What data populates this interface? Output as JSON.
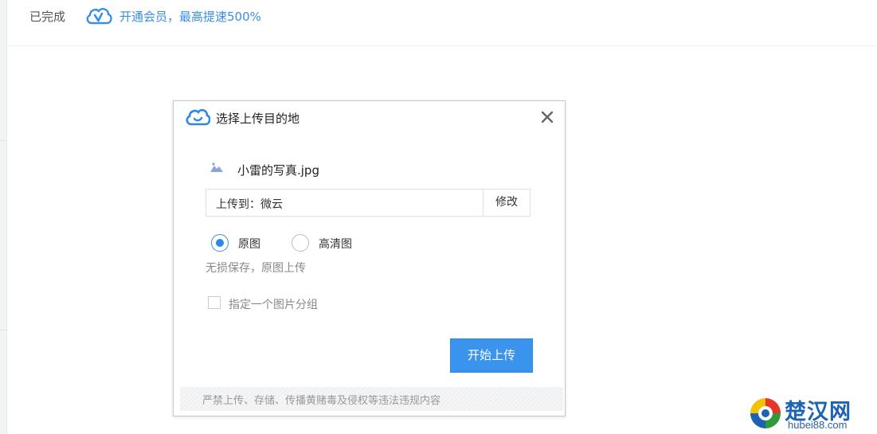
{
  "topbar": {
    "status_text": "已完成",
    "vip_link": "开通会员，最高提速500%"
  },
  "dialog": {
    "title": "选择上传目的地",
    "file_name": "小雷的写真.jpg",
    "destination_prefix": "上传到：",
    "destination_value": "微云",
    "modify_label": "修改",
    "quality_options": [
      {
        "label": "原图",
        "selected": true
      },
      {
        "label": "高清图",
        "selected": false
      }
    ],
    "quality_hint": "无损保存，原图上传",
    "group_checkbox_label": "指定一个图片分组",
    "group_checkbox_checked": false,
    "start_button": "开始上传",
    "footer_notice": "严禁上传、存储、传播黄赌毒及侵权等违法违规内容"
  },
  "watermark": {
    "title": "楚汉网",
    "subtitle": "hubei88.com"
  },
  "colors": {
    "accent": "#3a93ec",
    "link": "#3a8ee6",
    "watermark": "#1c62b5"
  },
  "icons": [
    "weiyun-vip-icon",
    "weiyun-cloud-icon",
    "close-icon",
    "image-file-icon",
    "chuhan-logo"
  ]
}
